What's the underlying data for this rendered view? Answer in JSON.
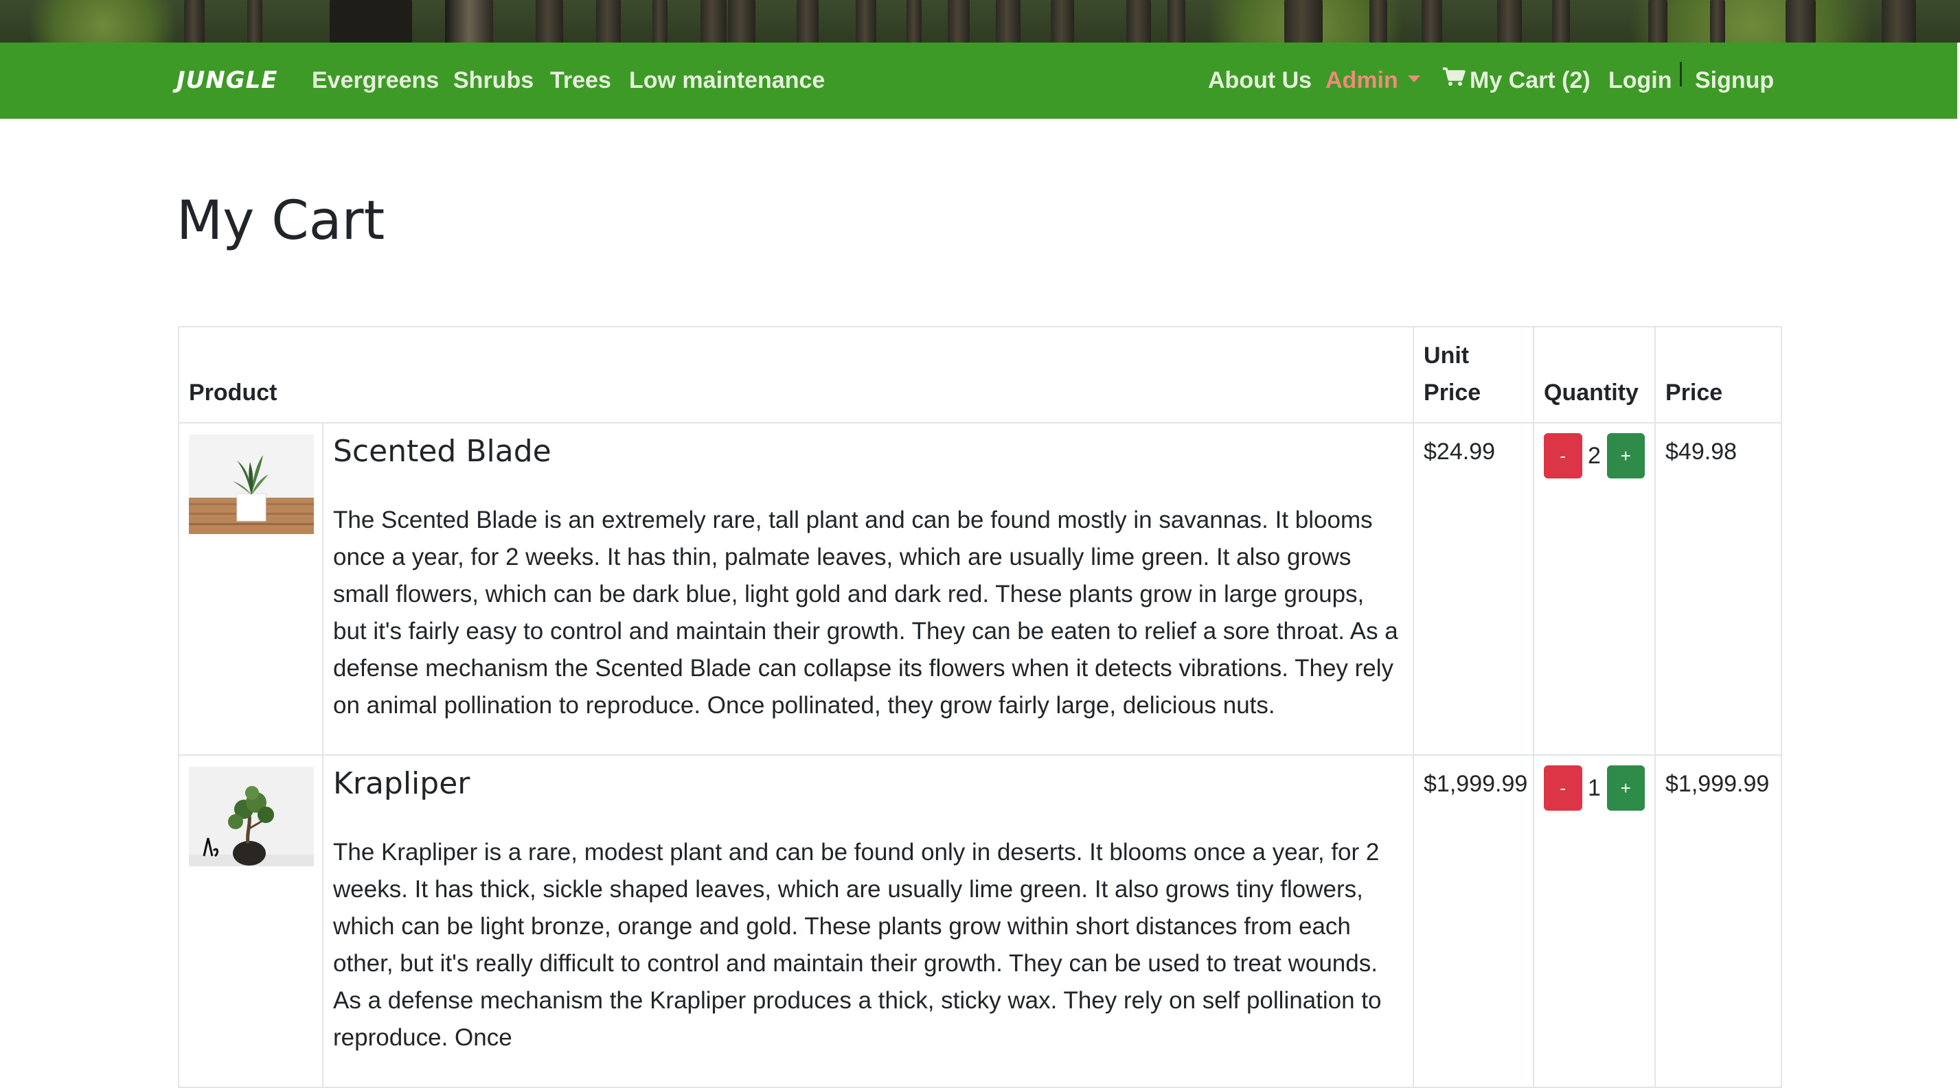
{
  "navbar": {
    "brand": "JUNGLE",
    "links": [
      "Evergreens",
      "Shrubs",
      "Trees",
      "Low maintenance"
    ],
    "right": {
      "about": "About Us",
      "admin": "Admin",
      "cart": "My Cart (2)",
      "login": "Login",
      "signup": "Signup"
    },
    "bg_color": "#3d9a27",
    "admin_color": "#f08a7a"
  },
  "page": {
    "title": "My Cart"
  },
  "table": {
    "headers": {
      "product": "Product",
      "unit_price_line1": "Unit",
      "unit_price_line2": "Price",
      "quantity": "Quantity",
      "price": "Price"
    },
    "rows": [
      {
        "name": "Scented Blade",
        "description": "The Scented Blade is an extremely rare, tall plant and can be found mostly in savannas. It blooms once a year, for 2 weeks. It has thin, palmate leaves, which are usually lime green. It also grows small flowers, which can be dark blue, light gold and dark red. These plants grow in large groups, but it's fairly easy to control and maintain their growth. They can be eaten to relief a sore throat. As a defense mechanism the Scented Blade can collapse its flowers when it detects vibrations. They rely on animal pollination to reproduce. Once pollinated, they grow fairly large, delicious nuts.",
        "unit_price": "$24.99",
        "minus": "-",
        "quantity": "2",
        "plus": "+",
        "price": "$49.98"
      },
      {
        "name": "Krapliper",
        "description": "The Krapliper is a rare, modest plant and can be found only in deserts. It blooms once a year, for 2 weeks. It has thick, sickle shaped leaves, which are usually lime green. It also grows tiny flowers, which can be light bronze, orange and gold. These plants grow within short distances from each other, but it's really difficult to control and maintain their growth. They can be used to treat wounds. As a defense mechanism the Krapliper produces a thick, sticky wax. They rely on self pollination to reproduce. Once",
        "unit_price": "$1,999.99",
        "minus": "-",
        "quantity": "1",
        "plus": "+",
        "price": "$1,999.99"
      }
    ]
  }
}
